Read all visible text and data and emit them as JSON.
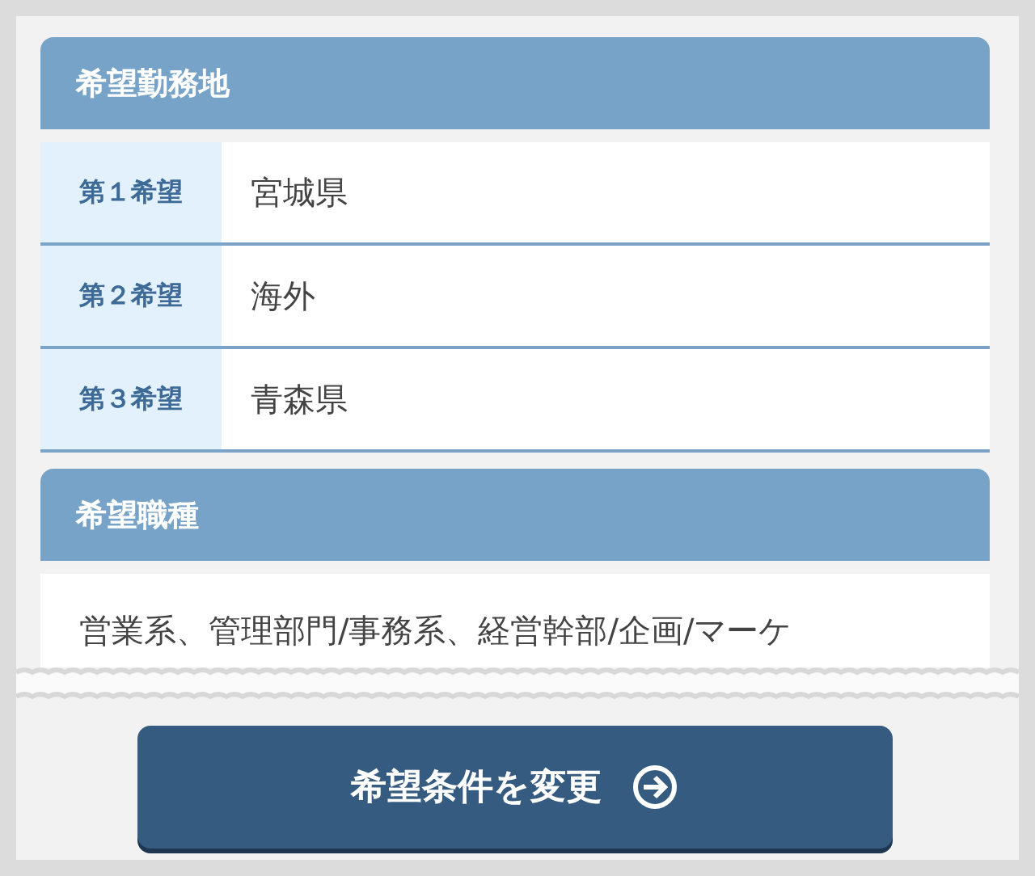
{
  "sections": [
    {
      "title": "希望勤務地",
      "kind": "table",
      "rows": [
        {
          "label": "第１希望",
          "value": "宮城県"
        },
        {
          "label": "第２希望",
          "value": "海外"
        },
        {
          "label": "第３希望",
          "value": "青森県"
        }
      ]
    },
    {
      "title": "希望職種",
      "kind": "text",
      "text": "営業系、管理部門/事務系、経営幹部/企画/マーケ"
    }
  ],
  "button": {
    "label": "希望条件を変更"
  }
}
